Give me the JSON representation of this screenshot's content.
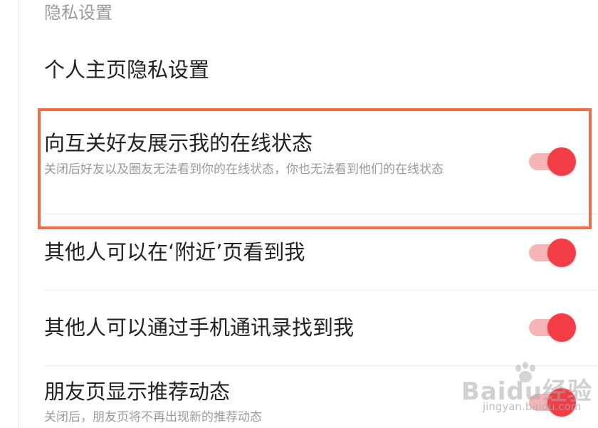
{
  "section_header": "隐私设置",
  "profile_privacy": {
    "title": "个人主页隐私设置"
  },
  "items": [
    {
      "title": "向互关好友展示我的在线状态",
      "desc": "关闭后好友以及圈友无法看到你的在线状态，你也无法看到他们的在线状态",
      "enabled": true
    },
    {
      "title": "其他人可以在‘附近’页看到我",
      "enabled": true
    },
    {
      "title": "其他人可以通过手机通讯录找到我",
      "enabled": true
    },
    {
      "title": "朋友页显示推荐动态",
      "desc": "关闭后，朋友页将不再出现新的推荐动态",
      "enabled": true
    }
  ],
  "watermark": {
    "brand": "Baidu经验",
    "url": "jingyan.baidu.com"
  },
  "colors": {
    "accent": "#f23c46",
    "track_on": "#f5b5b7",
    "highlight": "#f26b43",
    "secondary_text": "#9a9a9a"
  }
}
